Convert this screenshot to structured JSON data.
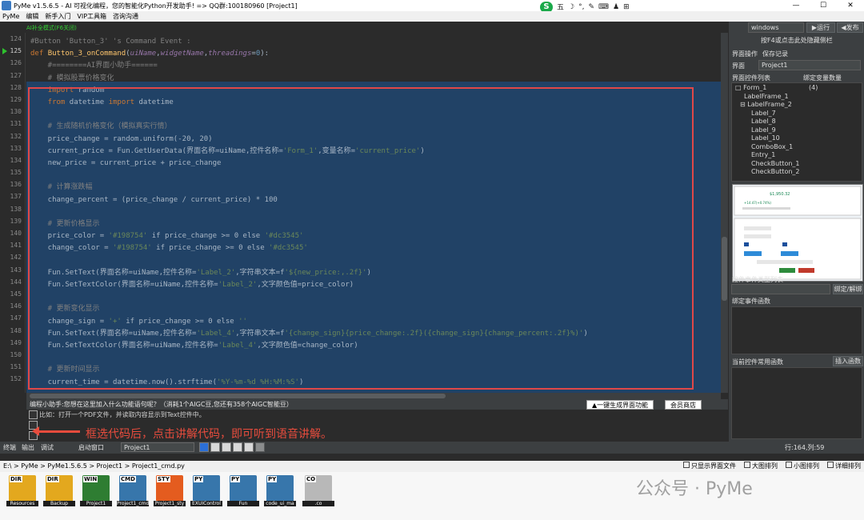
{
  "window": {
    "title": "PyMe v1.5.6.5 - AI 可视化编程，您的智能化Python开发助手!  => QQ群:100180960    [Project1]",
    "controls": [
      "—",
      "☐",
      "✕"
    ]
  },
  "ime": {
    "logo": "S",
    "items": [
      "五",
      "☽",
      "°,",
      "✎",
      "⌨",
      "♟",
      "⊞"
    ]
  },
  "menu": [
    "PyMe",
    "编辑",
    "新手入门",
    "VIP工具箱",
    "咨询沟通"
  ],
  "ai_mode": "AI补全模式(F6关闭)",
  "lines": [
    {
      "n": "124",
      "tokens": [
        {
          "t": "#Button 'Button_3' 's Command Event :",
          "c": "cm"
        }
      ]
    },
    {
      "n": "125",
      "cur": true,
      "tokens": [
        {
          "t": "def ",
          "c": "df"
        },
        {
          "t": "Button_3_onCommand",
          "c": "fu"
        },
        {
          "t": "(",
          "c": ""
        },
        {
          "t": "uiName",
          "c": "pr"
        },
        {
          "t": ",",
          "c": ""
        },
        {
          "t": "widgetName",
          "c": "pr"
        },
        {
          "t": ",",
          "c": ""
        },
        {
          "t": "threadings",
          "c": "pr"
        },
        {
          "t": "=",
          "c": ""
        },
        {
          "t": "0",
          "c": "nm"
        },
        {
          "t": "):",
          "c": ""
        }
      ]
    },
    {
      "n": "126",
      "tokens": [
        {
          "t": "    #========AI界面小助手======",
          "c": "cm"
        }
      ]
    },
    {
      "n": "127",
      "tokens": [
        {
          "t": "    # 模拟股票价格变化",
          "c": "cm"
        }
      ]
    },
    {
      "n": "128",
      "tokens": [
        {
          "t": "    import ",
          "c": "kw"
        },
        {
          "t": "random",
          "c": ""
        }
      ]
    },
    {
      "n": "129",
      "tokens": [
        {
          "t": "    from ",
          "c": "kw"
        },
        {
          "t": "datetime ",
          "c": ""
        },
        {
          "t": "import ",
          "c": "kw"
        },
        {
          "t": "datetime",
          "c": ""
        }
      ]
    },
    {
      "n": "130",
      "tokens": []
    },
    {
      "n": "131",
      "tokens": [
        {
          "t": "    # 生成随机价格变化（模拟真实行情）",
          "c": "cm"
        }
      ]
    },
    {
      "n": "132",
      "tokens": [
        {
          "t": "    price_change = random.uniform(-20, 20)",
          "c": ""
        }
      ]
    },
    {
      "n": "133",
      "tokens": [
        {
          "t": "    current_price = Fun.GetUserData(界面名称=uiName,控件名称=",
          "c": ""
        },
        {
          "t": "'Form_1'",
          "c": "st"
        },
        {
          "t": ",变量名称=",
          "c": ""
        },
        {
          "t": "'current_price'",
          "c": "st"
        },
        {
          "t": ")",
          "c": ""
        }
      ]
    },
    {
      "n": "134",
      "tokens": [
        {
          "t": "    new_price = current_price + price_change",
          "c": ""
        }
      ]
    },
    {
      "n": "135",
      "tokens": []
    },
    {
      "n": "136",
      "tokens": [
        {
          "t": "    # 计算涨跌幅",
          "c": "cm"
        }
      ]
    },
    {
      "n": "137",
      "tokens": [
        {
          "t": "    change_percent = (price_change / current_price) * 100",
          "c": ""
        }
      ]
    },
    {
      "n": "138",
      "tokens": []
    },
    {
      "n": "139",
      "tokens": [
        {
          "t": "    # 更新价格显示",
          "c": "cm"
        }
      ]
    },
    {
      "n": "140",
      "tokens": [
        {
          "t": "    price_color = ",
          "c": ""
        },
        {
          "t": "'#198754'",
          "c": "st"
        },
        {
          "t": " if price_change >= 0 else ",
          "c": ""
        },
        {
          "t": "'#dc3545'",
          "c": "st"
        }
      ]
    },
    {
      "n": "141",
      "tokens": [
        {
          "t": "    change_color = ",
          "c": ""
        },
        {
          "t": "'#198754'",
          "c": "st"
        },
        {
          "t": " if price_change >= 0 else ",
          "c": ""
        },
        {
          "t": "'#dc3545'",
          "c": "st"
        }
      ]
    },
    {
      "n": "142",
      "tokens": []
    },
    {
      "n": "143",
      "tokens": [
        {
          "t": "    Fun.SetText(界面名称=uiName,控件名称=",
          "c": ""
        },
        {
          "t": "'Label_2'",
          "c": "st"
        },
        {
          "t": ",字符串文本=f",
          "c": ""
        },
        {
          "t": "'${new_price:,.2f}'",
          "c": "st"
        },
        {
          "t": ")",
          "c": ""
        }
      ]
    },
    {
      "n": "144",
      "tokens": [
        {
          "t": "    Fun.SetTextColor(界面名称=uiName,控件名称=",
          "c": ""
        },
        {
          "t": "'Label_2'",
          "c": "st"
        },
        {
          "t": ",文字颜色值=price_color)",
          "c": ""
        }
      ]
    },
    {
      "n": "145",
      "tokens": []
    },
    {
      "n": "146",
      "tokens": [
        {
          "t": "    # 更新变化显示",
          "c": "cm"
        }
      ]
    },
    {
      "n": "147",
      "tokens": [
        {
          "t": "    change_sign = ",
          "c": ""
        },
        {
          "t": "'+'",
          "c": "st"
        },
        {
          "t": " if price_change >= 0 else ",
          "c": ""
        },
        {
          "t": "''",
          "c": "st"
        }
      ]
    },
    {
      "n": "148",
      "tokens": [
        {
          "t": "    Fun.SetText(界面名称=uiName,控件名称=",
          "c": ""
        },
        {
          "t": "'Label_4'",
          "c": "st"
        },
        {
          "t": ",字符串文本=f",
          "c": ""
        },
        {
          "t": "'{change_sign}{price_change:.2f}({change_sign}{change_percent:.2f}%)'",
          "c": "st"
        },
        {
          "t": ")",
          "c": ""
        }
      ]
    },
    {
      "n": "149",
      "tokens": [
        {
          "t": "    Fun.SetTextColor(界面名称=uiName,控件名称=",
          "c": ""
        },
        {
          "t": "'Label_4'",
          "c": "st"
        },
        {
          "t": ",文字颜色值=change_color)",
          "c": ""
        }
      ]
    },
    {
      "n": "150",
      "tokens": []
    },
    {
      "n": "151",
      "tokens": [
        {
          "t": "    # 更新时间显示",
          "c": "cm"
        }
      ]
    },
    {
      "n": "152",
      "tokens": [
        {
          "t": "    current_time = datetime.now().strftime(",
          "c": ""
        },
        {
          "t": "'%Y-%m-%d %H:%M:%S'",
          "c": "st"
        },
        {
          "t": ")",
          "c": ""
        }
      ]
    }
  ],
  "right": {
    "platform": "windows",
    "run": "▶运行",
    "publish": "◀发布",
    "hint": "按F4或点击此处隐藏侧栏",
    "tab1": "界面操作",
    "tab2": "保存记录",
    "ui_label": "界面",
    "ui_value": "Project1",
    "list_label": "界面控件列表",
    "bind_count": "绑定变量数量",
    "tree": [
      {
        "t": "□ Form_1",
        "x": 4,
        "c": "(4)"
      },
      {
        "t": "LabelFrame_1",
        "x": 15
      },
      {
        "t": "⊟ LabelFrame_2",
        "x": 10
      },
      {
        "t": "Label_7",
        "x": 24
      },
      {
        "t": "Label_8",
        "x": 24
      },
      {
        "t": "Label_9",
        "x": 24
      },
      {
        "t": "Label_10",
        "x": 24
      },
      {
        "t": "ComboBox_1",
        "x": 24
      },
      {
        "t": "Entry_1",
        "x": 24
      },
      {
        "t": "CheckButton_1",
        "x": 24
      },
      {
        "t": "CheckButton_2",
        "x": 24
      }
    ],
    "preview": {
      "price": "$1,950.32",
      "change": "+14.47(+0.74%)"
    },
    "event_types": "控件事件类型列表",
    "bind_btn": "绑定/解绑",
    "bound_events": "绑定事件函数",
    "common_funcs": "当前控件常用函数",
    "insert_btn": "插入函数"
  },
  "bottom": {
    "assistant": "编程小助手:您想在这里加入什么功能语句呢？（消耗1个AIGC豆,您还有358个AIGC智能豆）",
    "gen_btn": "▲一键生成界面功能",
    "vip_btn": "会员商店",
    "example": "比如：打开一个PDF文件，并读取内容显示到Text控件中。",
    "note": "框选代码后，点击讲解代码，即可听到语音讲解。"
  },
  "tabs": {
    "t1": "终端",
    "t2": "输出",
    "t3": "调试",
    "launch": "启动窗口",
    "project": "Project1",
    "pos": "行:164,列:59"
  },
  "path": {
    "text": "E:\\ > PyMe > PyMe1.5.6.5 > Project1 > Project1_cmd.py",
    "opt1": "只显示界面文件",
    "opt2": "大图排列",
    "opt3": "小图排列",
    "opt4": "详细排列"
  },
  "files": [
    {
      "tag": "DIR",
      "label": "Resources",
      "color": "#e3a81e"
    },
    {
      "tag": "DIR",
      "label": "Backup",
      "color": "#e3a81e"
    },
    {
      "tag": "WIN",
      "label": "Project1",
      "color": "#2e7d32"
    },
    {
      "tag": "CMD",
      "label": "Project1_cmd",
      "color": "#3776ab"
    },
    {
      "tag": "STY",
      "label": "Project1_sty",
      "color": "#e45c1f"
    },
    {
      "tag": "PY",
      "label": "EXUIControl",
      "color": "#3776ab"
    },
    {
      "tag": "PY",
      "label": "Fun",
      "color": "#3776ab"
    },
    {
      "tag": "PY",
      "label": "code_ui_ma",
      "color": "#3776ab"
    },
    {
      "tag": "CO",
      "label": ".co",
      "color": "#b8b8b8"
    }
  ],
  "watermark": "公众号 · PyMe"
}
